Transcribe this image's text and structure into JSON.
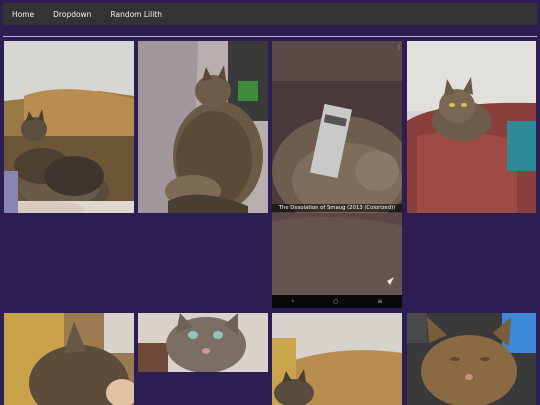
{
  "nav": {
    "items": [
      {
        "label": "Home"
      },
      {
        "label": "Dropdown"
      },
      {
        "label": "Random Lilith"
      }
    ]
  },
  "gallery": {
    "caption": "The Desolation of Smaug (2013 (Colorized))",
    "phone_nav_icons": [
      "back-icon",
      "home-circle-icon",
      "recents-icon"
    ]
  },
  "colors": {
    "page_background": "#2c1d52",
    "navbar_background": "#333333",
    "nav_text": "#f2f2f2",
    "divider": "#b9b0d6"
  }
}
